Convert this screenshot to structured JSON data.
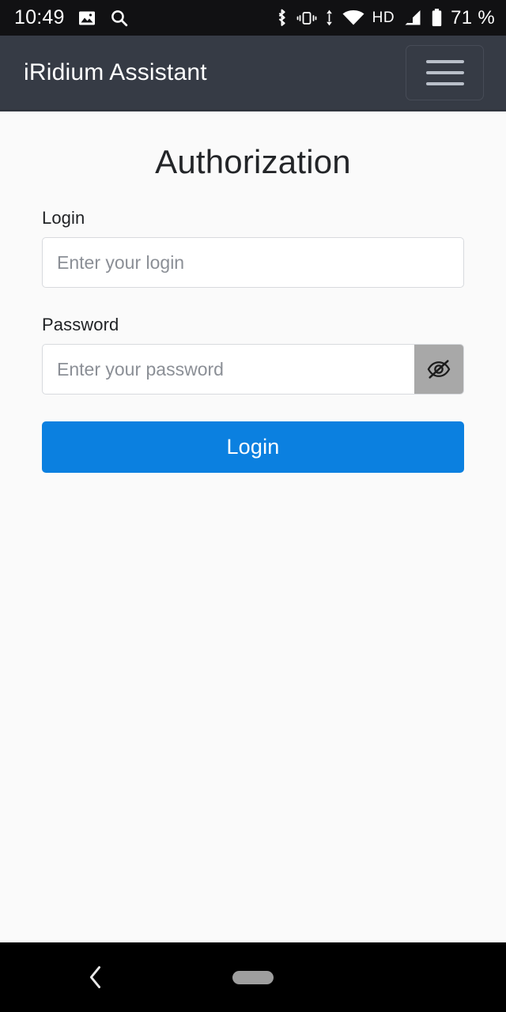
{
  "status_bar": {
    "time": "10:49",
    "left_icons": [
      {
        "name": "gallery-icon",
        "label": "gallery"
      },
      {
        "name": "search-icon",
        "label": "search"
      }
    ],
    "right_icons": [
      {
        "name": "bluetooth-icon",
        "label": "bluetooth"
      },
      {
        "name": "vibrate-icon",
        "label": "vibrate"
      },
      {
        "name": "data-transfer-icon",
        "label": "data transfer"
      },
      {
        "name": "wifi-icon",
        "label": "wifi"
      },
      {
        "name": "hd-icon",
        "label": "HD"
      },
      {
        "name": "cellular-signal-icon",
        "label": "signal"
      },
      {
        "name": "battery-icon",
        "label": "battery"
      }
    ],
    "hd_label": "HD",
    "battery_percent": "71 %",
    "background_color": "#111113"
  },
  "app_bar": {
    "title": "iRidium Assistant",
    "menu_icon": "hamburger-menu-icon",
    "background_color": "#363b45",
    "title_color": "#ffffff"
  },
  "main": {
    "page_title": "Authorization",
    "login_field": {
      "label": "Login",
      "placeholder": "Enter your login",
      "value": ""
    },
    "password_field": {
      "label": "Password",
      "placeholder": "Enter your password",
      "value": "",
      "toggle_icon": "eye-slash-icon",
      "toggle_state": "hidden",
      "toggle_background": "#a8a8a8"
    },
    "submit_button": {
      "label": "Login",
      "background_color": "#0b80e0",
      "text_color": "#ffffff"
    },
    "background_color": "#fafafa"
  },
  "nav_bar": {
    "back_icon": "back-chevron-icon",
    "home_icon": "home-pill-icon",
    "background_color": "#000000"
  }
}
